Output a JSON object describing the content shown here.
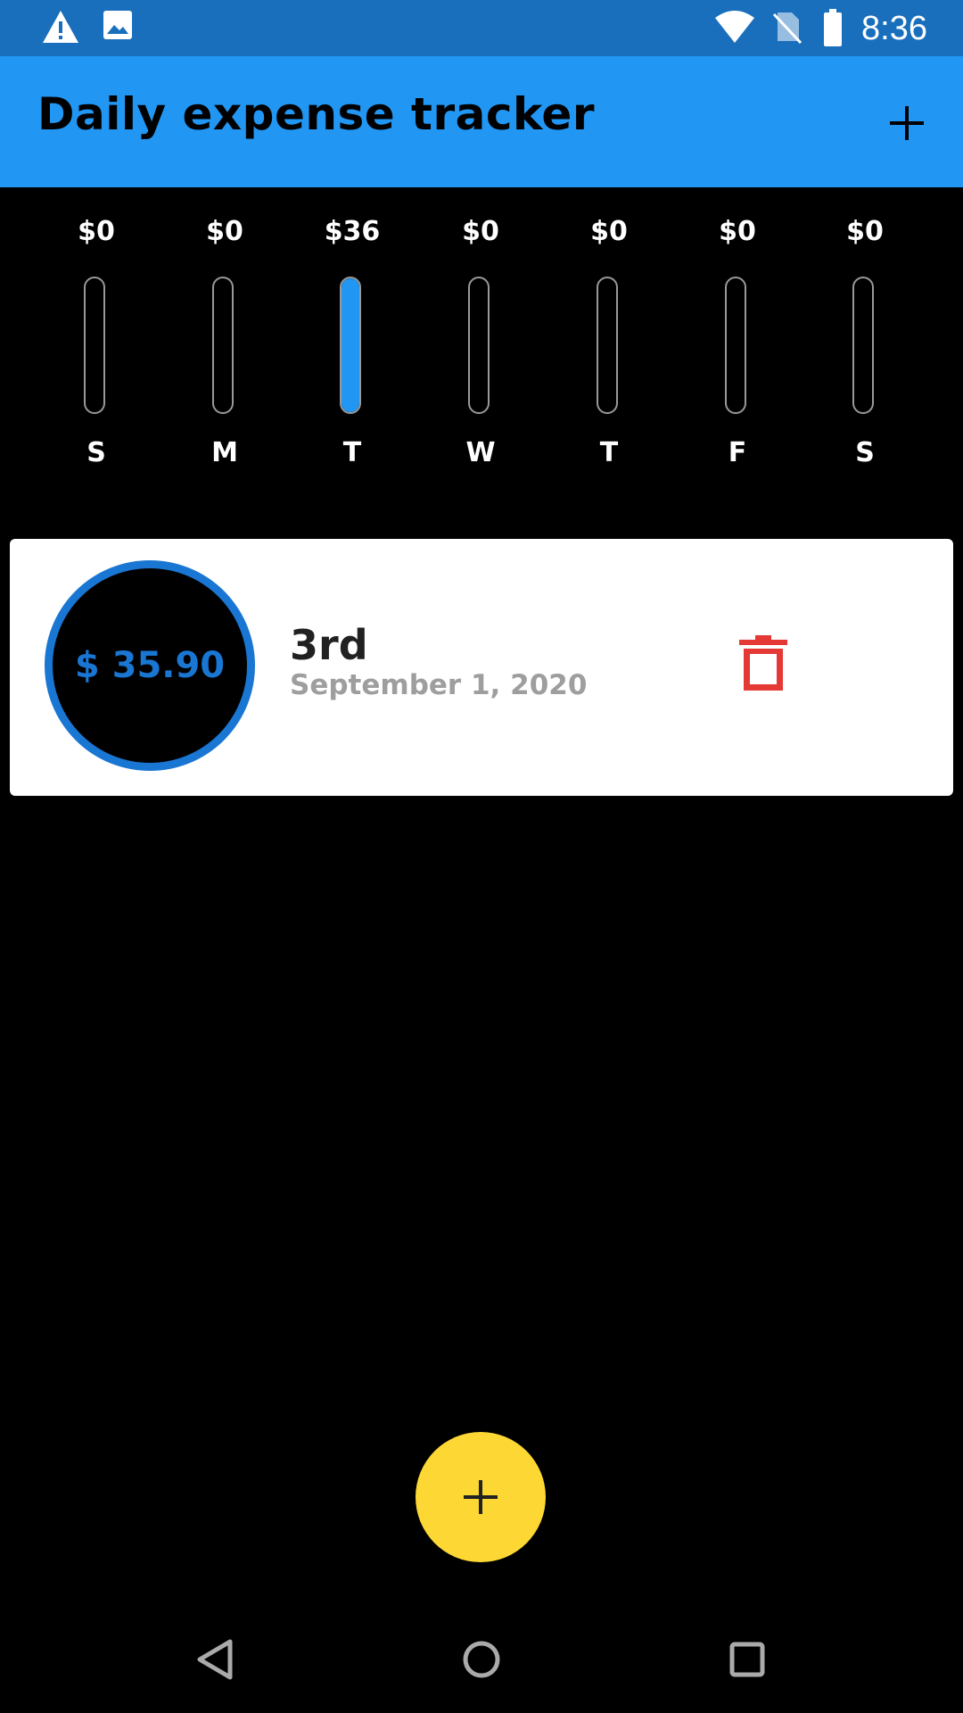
{
  "status_bar": {
    "time": "8:36",
    "icons": [
      "warning-icon",
      "image-icon",
      "wifi-icon",
      "no-sim-icon",
      "battery-icon"
    ]
  },
  "app_bar": {
    "title": "Daily expense tracker",
    "add_icon": "plus-icon"
  },
  "weekly_chart": [
    {
      "day": "S",
      "amount": "$0",
      "fill": 0
    },
    {
      "day": "M",
      "amount": "$0",
      "fill": 0
    },
    {
      "day": "T",
      "amount": "$36",
      "fill": 1
    },
    {
      "day": "W",
      "amount": "$0",
      "fill": 0
    },
    {
      "day": "T",
      "amount": "$0",
      "fill": 0
    },
    {
      "day": "F",
      "amount": "$0",
      "fill": 0
    },
    {
      "day": "S",
      "amount": "$0",
      "fill": 0
    }
  ],
  "transactions": [
    {
      "amount": "$ 35.90",
      "title": "3rd",
      "date": "September 1, 2020",
      "delete_icon": "trash-icon"
    }
  ],
  "fab": {
    "icon": "plus-icon"
  },
  "nav_bar": {
    "icons": [
      "back-icon",
      "home-icon",
      "recents-icon"
    ]
  },
  "colors": {
    "status_bar": "#1a6fbd",
    "app_bar": "#2196f3",
    "bar_fill": "#2196f3",
    "amount_accent": "#1976d2",
    "delete": "#e53935",
    "fab": "#fdd835",
    "background": "#000000"
  }
}
